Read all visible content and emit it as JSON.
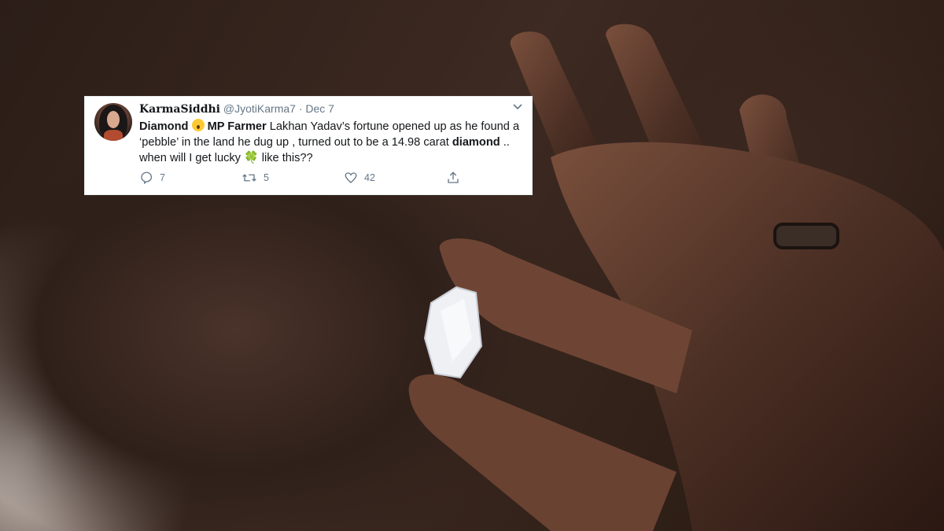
{
  "tweet": {
    "display_name": "KarmaSiddhi",
    "handle": "@JyotiKarma7",
    "separator": "·",
    "date": "Dec 7",
    "text_word_1": "Diamond",
    "text_bold_2": "MP Farmer",
    "text_part_3": " Lakhan Yadav’s fortune opened up as he found a ‘pebble’ in the land he dug up , turned out to be a 14.98 carat ",
    "text_bold_4": "diamond",
    "text_part_5": " .. when will I get lucky ",
    "text_emoji_clover": "🍀",
    "text_part_6": " like this??",
    "replies": "7",
    "retweets": "5",
    "likes": "42"
  },
  "icons": [
    "avatar",
    "chevron-down-icon",
    "surprised-face-emoji",
    "clover-emoji",
    "reply-icon",
    "retweet-icon",
    "like-icon",
    "share-icon"
  ],
  "colors": {
    "text": "#14171a",
    "muted": "#657786",
    "card": "#ffffff"
  }
}
